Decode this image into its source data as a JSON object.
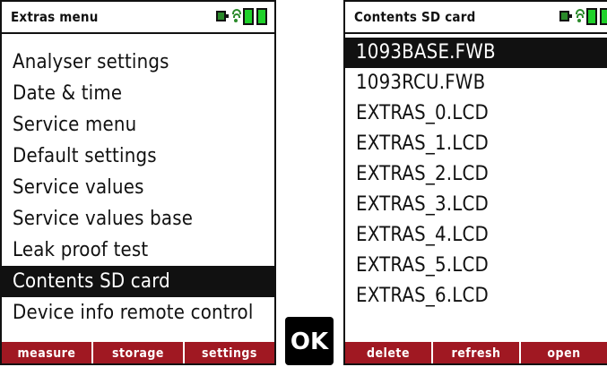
{
  "left_screen": {
    "title": "Extras menu",
    "items": [
      "Analyser settings",
      "Date & time",
      "Service menu",
      "Default settings",
      "Service values",
      "Service values base",
      "Leak proof test",
      "Contents SD card",
      "Device info remote control"
    ],
    "selected_index": 7,
    "softkeys": [
      "measure",
      "storage",
      "settings"
    ]
  },
  "ok_key": "OK",
  "right_screen": {
    "title": "Contents SD card",
    "items": [
      "1093BASE.FWB",
      "1093RCU.FWB",
      "EXTRAS_0.LCD",
      "EXTRAS_1.LCD",
      "EXTRAS_2.LCD",
      "EXTRAS_3.LCD",
      "EXTRAS_4.LCD",
      "EXTRAS_5.LCD",
      "EXTRAS_6.LCD"
    ],
    "selected_index": 0,
    "softkeys": [
      "delete",
      "refresh",
      "open"
    ]
  },
  "icons": [
    "device-icon",
    "wireless-icon",
    "battery-icon"
  ],
  "colors": {
    "softkey_bar": "#a01822",
    "battery": "#1fd12a",
    "selection": "#111111"
  }
}
